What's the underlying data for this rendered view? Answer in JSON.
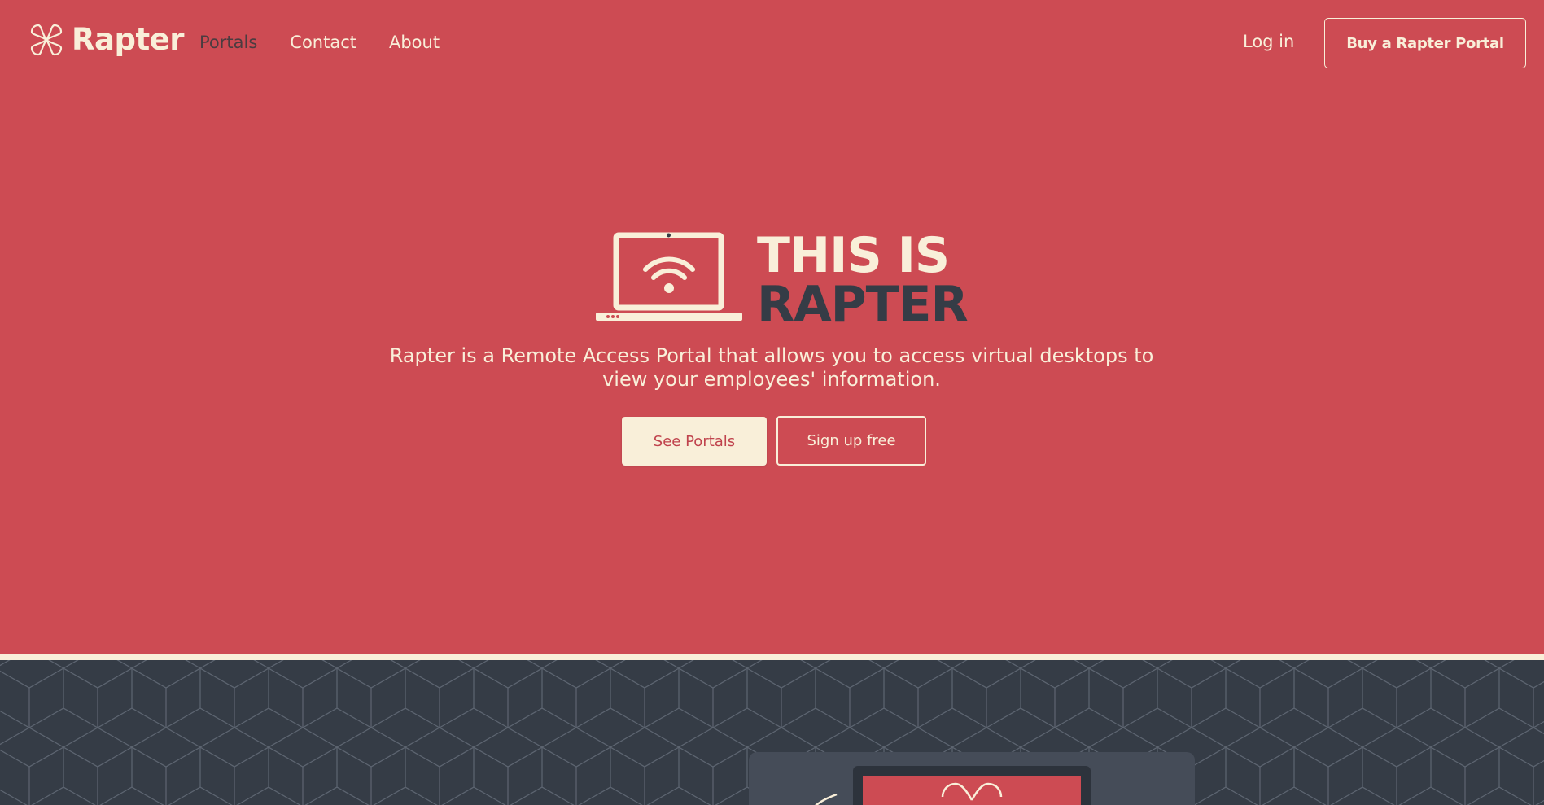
{
  "brand": {
    "name": "Rapter",
    "logo_icon": "four-petal-clover-icon"
  },
  "nav": {
    "items": [
      {
        "label": "Portals",
        "active": true
      },
      {
        "label": "Contact",
        "active": false
      },
      {
        "label": "About",
        "active": false
      }
    ]
  },
  "header": {
    "login_label": "Log in",
    "buy_label": "Buy a Rapter Portal"
  },
  "hero": {
    "icon": "laptop-wifi-icon",
    "title_line1": "THIS IS",
    "title_line2": "RAPTER",
    "description": "Rapter is a Remote Access Portal that allows you to access virtual desktops to view your employees' information.",
    "primary_button": "See Portals",
    "secondary_button": "Sign up free"
  },
  "colors": {
    "brand_red": "#cd4b53",
    "cream": "#f9efd9",
    "dark_slate": "#353c46",
    "card_gray": "#454c58"
  }
}
